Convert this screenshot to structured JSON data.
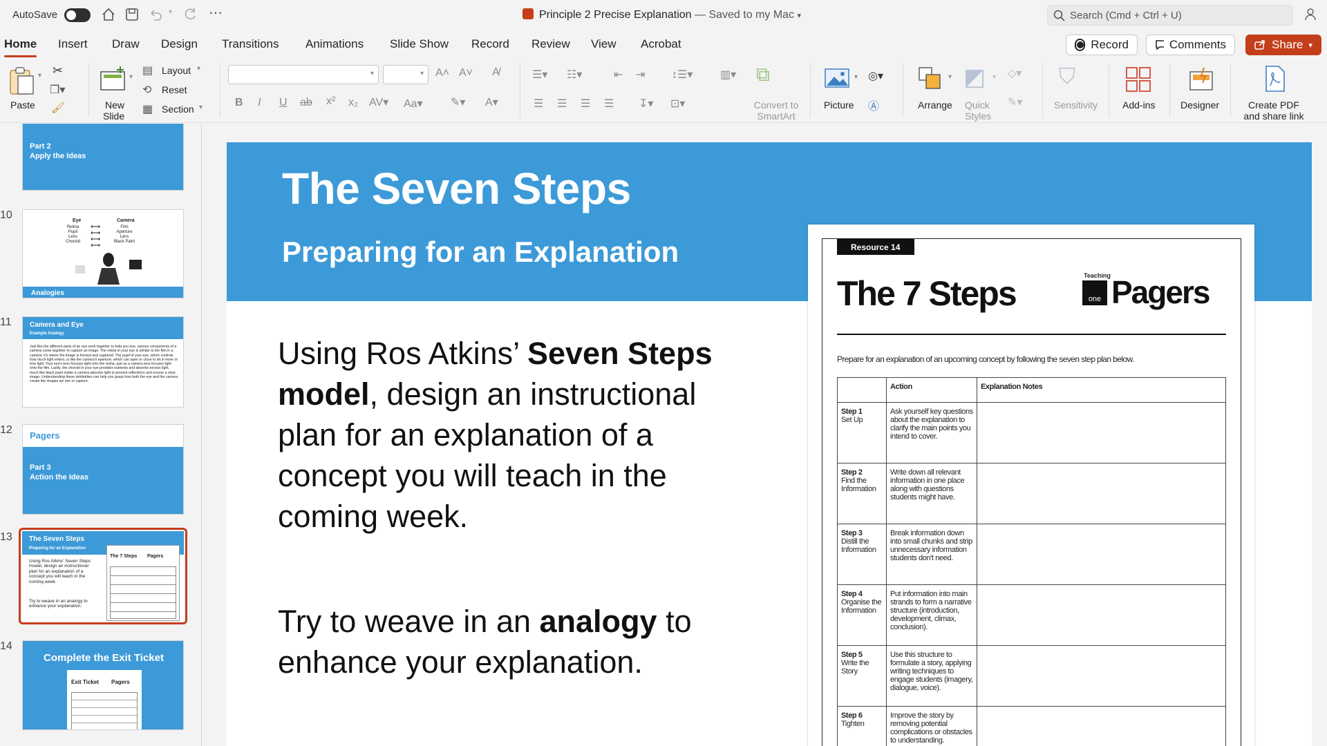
{
  "titlebar": {
    "autosave": "AutoSave",
    "doc_title": "Principle 2 Precise Explanation",
    "save_status": "— Saved to my Mac",
    "search_placeholder": "Search (Cmd + Ctrl + U)"
  },
  "tabs": [
    "Home",
    "Insert",
    "Draw",
    "Design",
    "Transitions",
    "Animations",
    "Slide Show",
    "Record",
    "Review",
    "View",
    "Acrobat"
  ],
  "actions": {
    "record": "Record",
    "comments": "Comments",
    "share": "Share"
  },
  "ribbon": {
    "paste": "Paste",
    "new_slide_1": "New",
    "new_slide_2": "Slide",
    "layout": "Layout",
    "reset": "Reset",
    "section": "Section",
    "convert_1": "Convert to",
    "convert_2": "SmartArt",
    "picture": "Picture",
    "arrange": "Arrange",
    "quick_1": "Quick",
    "quick_2": "Styles",
    "sensitivity": "Sensitivity",
    "addins": "Add-ins",
    "designer": "Designer",
    "pdf_1": "Create PDF",
    "pdf_2": "and share link"
  },
  "thumbnails": {
    "t9": {
      "part": "Part 2",
      "title": "Apply the Ideas"
    },
    "t10": {
      "num": "10",
      "eye": "Eye",
      "camera": "Camera",
      "eye_parts": "Retina\nPupil\nLens\nChoroid",
      "camera_parts": "Film\nAperture\nLens\nBlack Paint",
      "caption": "Analogies"
    },
    "t11": {
      "num": "11",
      "title": "Camera and Eye",
      "subtitle": "Example Analogy",
      "text": "Just like the different parts of an eye work together to help you see, various components of a camera come together to capture an image. The retina in your eye is similar to the film in a camera; it's where the image is formed and captured. The pupil of your eye, which controls how much light enters, is like the camera's aperture, which can open or close to let in more or less light. Your eye's lens focuses light onto the retina, just as a camera lens focuses light onto the film. Lastly, the choroid in your eye provides nutrients and absorbs excess light, much like black paint inside a camera absorbs light to prevent reflections and ensure a clear image. Understanding these similarities can help you grasp how both the eye and the camera create the images we see or capture."
    },
    "t12": {
      "num": "12",
      "logo": "Pagers",
      "part": "Part 3",
      "title": "Action the Ideas"
    },
    "t13": {
      "num": "13",
      "title": "The Seven Steps",
      "subtitle": "Preparing for an Explanation",
      "body": "Using Ros Atkins' Seven Steps model, design an instructional plan for an explanation of a concept you will teach in the coming week.",
      "body2": "Try to weave in an analogy to enhance your explanation.",
      "doc_title": "The 7 Steps",
      "logo": "Pagers"
    },
    "t14": {
      "num": "14",
      "title": "Complete the Exit Ticket",
      "doc_title": "Exit Ticket",
      "logo": "Pagers"
    }
  },
  "slide": {
    "title": "The Seven Steps",
    "subtitle": "Preparing for an Explanation",
    "p1_a": "Using Ros Atkins’ ",
    "p1_b": "Seven Steps model",
    "p1_c": ", design an instructional plan for an explanation of a concept you will teach in the coming week.",
    "p2_a": "Try to weave in an ",
    "p2_b": "analogy",
    "p2_c": " to enhance your explanation."
  },
  "resource": {
    "tag": "Resource 14",
    "title": "The 7 Steps",
    "logo_small": "Teaching",
    "logo_box": "one",
    "logo": "Pagers",
    "intro": "Prepare for an explanation of an upcoming concept by following the seven step plan below.",
    "headers": [
      "",
      "Action",
      "Explanation Notes"
    ],
    "rows": [
      {
        "step": "Step 1",
        "name": "Set Up",
        "action": "Ask yourself key questions about the explanation to clarify the main points you intend to cover."
      },
      {
        "step": "Step 2",
        "name": "Find the Information",
        "action": "Write down all relevant information in one place along with questions students might have."
      },
      {
        "step": "Step 3",
        "name": "Distill the Information",
        "action": "Break information down into small chunks and strip unnecessary information students don't need."
      },
      {
        "step": "Step 4",
        "name": "Organise the Information",
        "action": "Put information into main strands to form a narrative structure (introduction, development, climax, conclusion)."
      },
      {
        "step": "Step 5",
        "name": "Write the Story",
        "action": "Use this structure to formulate a story, applying writing techniques to engage students (imagery, dialogue, voice)."
      },
      {
        "step": "Step 6",
        "name": "Tighten",
        "action": "Improve the story by removing potential complications or obstacles to understanding."
      }
    ]
  },
  "colors": {
    "accent": "#c43e1c",
    "slide_blue": "#3d9ad8",
    "share": "#c43e1c"
  }
}
